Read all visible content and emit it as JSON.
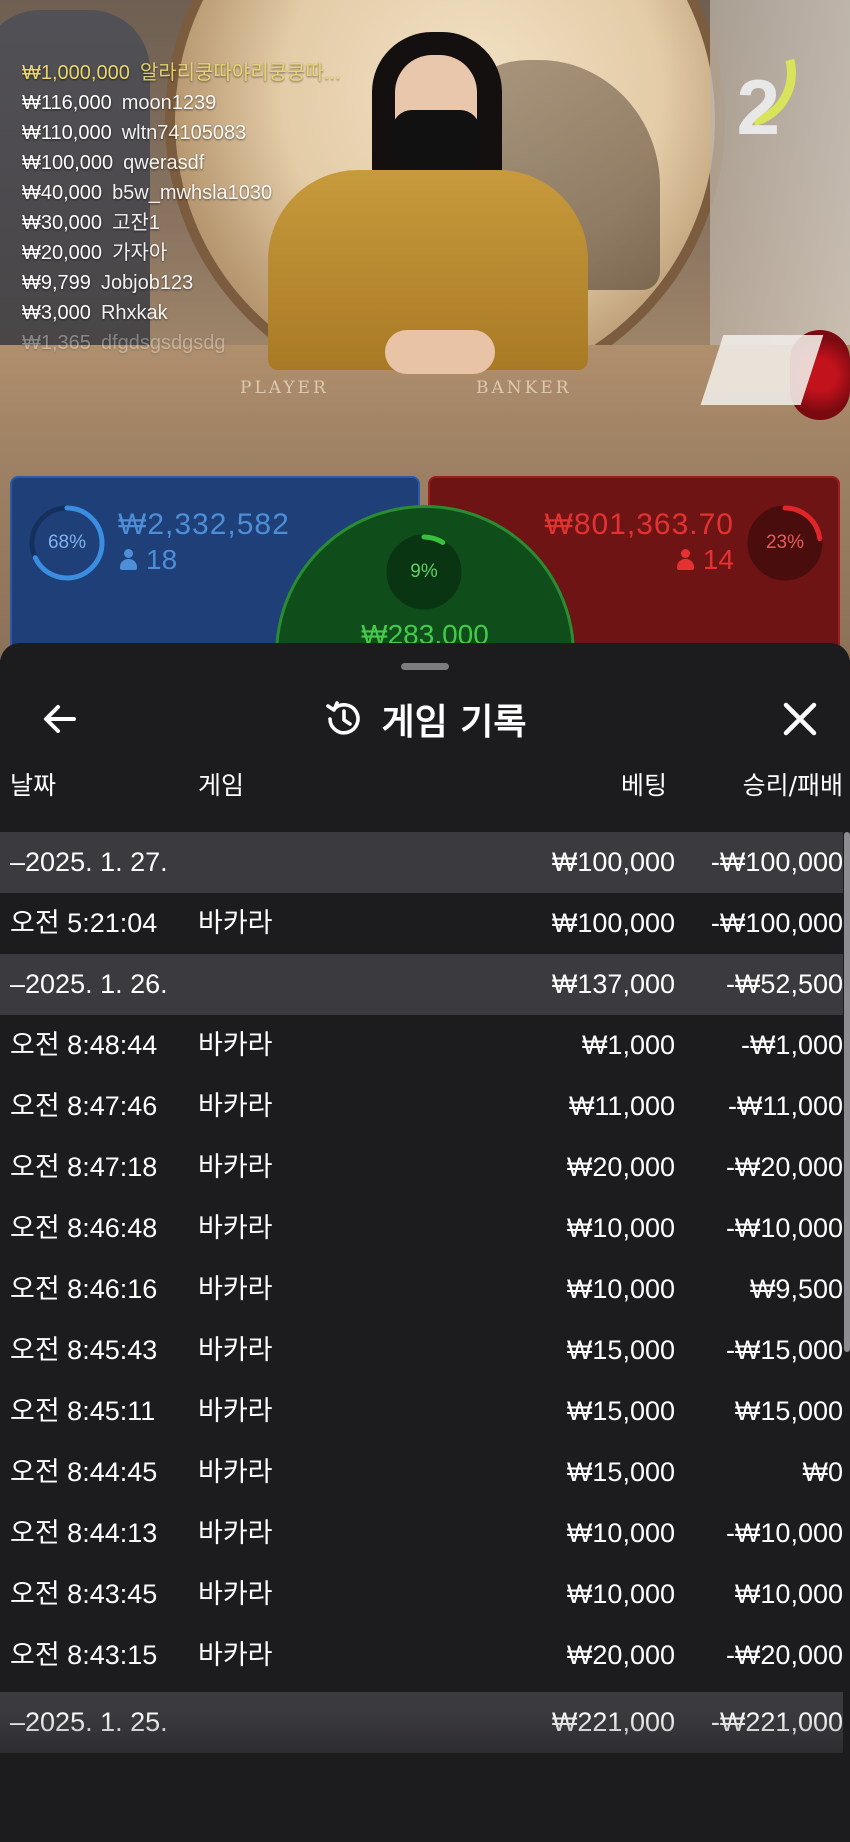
{
  "stream": {
    "countdown": "2",
    "table_labels": {
      "player": "PLAYER",
      "banker": "BANKER"
    },
    "chat": [
      {
        "amount": "₩1,000,000",
        "user": "알라리쿵따야리쿵쿵따...",
        "style": "gold"
      },
      {
        "amount": "₩116,000",
        "user": "moon1239",
        "style": "normal"
      },
      {
        "amount": "₩110,000",
        "user": "wltn74105083",
        "style": "normal"
      },
      {
        "amount": "₩100,000",
        "user": "qwerasdf",
        "style": "normal"
      },
      {
        "amount": "₩40,000",
        "user": "b5w_mwhsla1030",
        "style": "normal"
      },
      {
        "amount": "₩30,000",
        "user": "고잔1",
        "style": "normal"
      },
      {
        "amount": "₩20,000",
        "user": "가자아",
        "style": "normal"
      },
      {
        "amount": "₩9,799",
        "user": "Jobjob123",
        "style": "normal"
      },
      {
        "amount": "₩3,000",
        "user": "Rhxkak",
        "style": "normal"
      },
      {
        "amount": "₩1,365",
        "user": "dfgdsgsdgsdg",
        "style": "fade"
      }
    ]
  },
  "bets": {
    "player": {
      "percent": "68%",
      "percent_value": 0.68,
      "total": "₩2,332,582",
      "players": "18",
      "color": "#3b8de0"
    },
    "banker": {
      "percent": "23%",
      "percent_value": 0.23,
      "total": "₩801,363.70",
      "players": "14",
      "color": "#e0262a"
    },
    "tie": {
      "percent": "9%",
      "percent_value": 0.09,
      "total": "₩283,000",
      "color": "#36c23c"
    }
  },
  "history": {
    "title": "게임 기록",
    "icons": {
      "back": "arrow-left-icon",
      "title": "history-icon",
      "close": "close-icon"
    },
    "columns": {
      "date": "날짜",
      "game": "게임",
      "bet": "베팅",
      "result": "승리/패배"
    },
    "rows": [
      {
        "type": "date",
        "date": "–2025. 1. 27.",
        "game": "",
        "bet": "₩100,000",
        "result": "-₩100,000"
      },
      {
        "type": "entry",
        "date": "오전 5:21:04",
        "game": "바카라",
        "bet": "₩100,000",
        "result": "-₩100,000"
      },
      {
        "type": "date",
        "date": "–2025. 1. 26.",
        "game": "",
        "bet": "₩137,000",
        "result": "-₩52,500"
      },
      {
        "type": "entry",
        "date": "오전 8:48:44",
        "game": "바카라",
        "bet": "₩1,000",
        "result": "-₩1,000"
      },
      {
        "type": "entry",
        "date": "오전 8:47:46",
        "game": "바카라",
        "bet": "₩11,000",
        "result": "-₩11,000"
      },
      {
        "type": "entry",
        "date": "오전 8:47:18",
        "game": "바카라",
        "bet": "₩20,000",
        "result": "-₩20,000"
      },
      {
        "type": "entry",
        "date": "오전 8:46:48",
        "game": "바카라",
        "bet": "₩10,000",
        "result": "-₩10,000"
      },
      {
        "type": "entry",
        "date": "오전 8:46:16",
        "game": "바카라",
        "bet": "₩10,000",
        "result": "₩9,500"
      },
      {
        "type": "entry",
        "date": "오전 8:45:43",
        "game": "바카라",
        "bet": "₩15,000",
        "result": "-₩15,000"
      },
      {
        "type": "entry",
        "date": "오전 8:45:11",
        "game": "바카라",
        "bet": "₩15,000",
        "result": "₩15,000"
      },
      {
        "type": "entry",
        "date": "오전 8:44:45",
        "game": "바카라",
        "bet": "₩15,000",
        "result": "₩0"
      },
      {
        "type": "entry",
        "date": "오전 8:44:13",
        "game": "바카라",
        "bet": "₩10,000",
        "result": "-₩10,000"
      },
      {
        "type": "entry",
        "date": "오전 8:43:45",
        "game": "바카라",
        "bet": "₩10,000",
        "result": "₩10,000"
      },
      {
        "type": "entry",
        "date": "오전 8:43:15",
        "game": "바카라",
        "bet": "₩20,000",
        "result": "-₩20,000"
      },
      {
        "type": "date",
        "date": "–2025. 1. 25.",
        "game": "",
        "bet": "₩221,000",
        "result": "-₩221,000"
      }
    ]
  }
}
